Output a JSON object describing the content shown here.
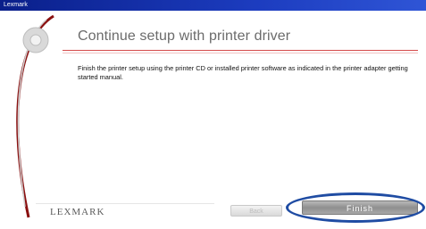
{
  "window": {
    "title": "Lexmark"
  },
  "header": {
    "title": "Continue setup with printer driver"
  },
  "content": {
    "message": "Finish the printer setup using the printer CD or installed printer software as indicated in the printer adapter getting started manual."
  },
  "footer": {
    "brand": "LEXMARK",
    "back_label": "Back",
    "finish_label": "Finish"
  },
  "colors": {
    "titlebar": "#0a1f8a",
    "accent_rule": "#d44a4a",
    "highlight_ellipse": "#1f4ca3"
  }
}
